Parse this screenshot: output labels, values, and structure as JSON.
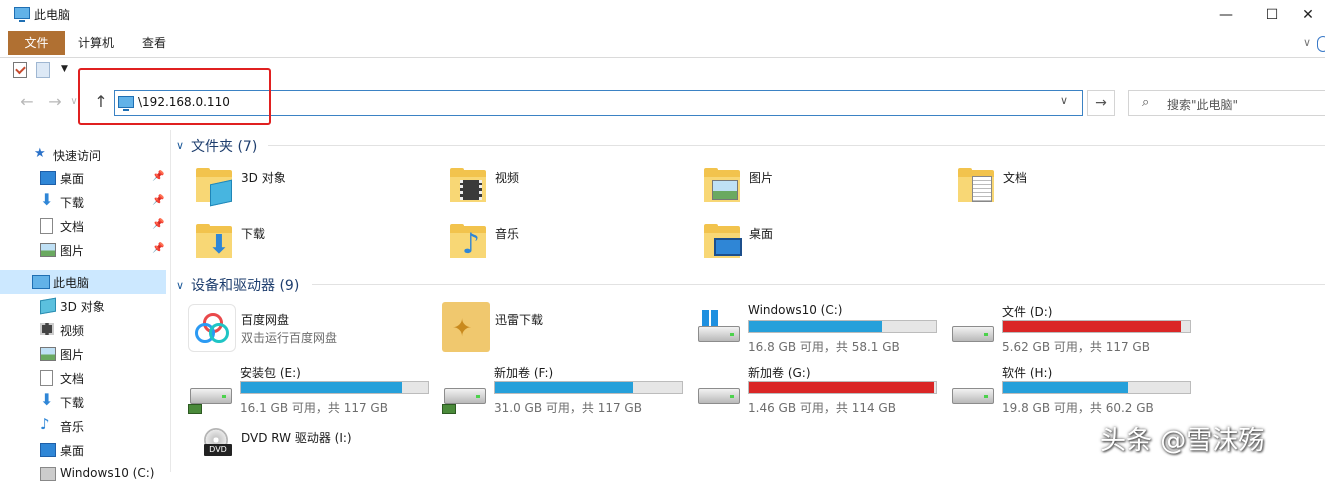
{
  "window": {
    "title": "此电脑",
    "minimize": "—",
    "maximize": "☐",
    "close": "✕"
  },
  "ribbon": {
    "tab_file": "文件",
    "tab_computer": "计算机",
    "tab_view": "查看",
    "collapse": "∨"
  },
  "qat": {
    "dropdown": "▼"
  },
  "nav": {
    "back": "←",
    "forward": "→",
    "recent": "∨",
    "up": "↑"
  },
  "address": {
    "value": "\\192.168.0.110",
    "dropdown": "∨",
    "go": "→"
  },
  "search": {
    "icon": "⌕",
    "placeholder": "搜索\"此电脑\""
  },
  "sidebar": {
    "quick_access": "快速访问",
    "items": [
      {
        "label": "桌面",
        "pinned": "📌",
        "icon": "desktop-icon"
      },
      {
        "label": "下载",
        "pinned": "📌",
        "icon": "download-icon"
      },
      {
        "label": "文档",
        "pinned": "📌",
        "icon": "documents-icon"
      },
      {
        "label": "图片",
        "pinned": "📌",
        "icon": "pictures-icon"
      }
    ],
    "this_pc": "此电脑",
    "pc_items": [
      {
        "label": "3D 对象",
        "icon": "3d-objects-icon"
      },
      {
        "label": "视频",
        "icon": "videos-icon"
      },
      {
        "label": "图片",
        "icon": "pictures-icon"
      },
      {
        "label": "文档",
        "icon": "documents-icon"
      },
      {
        "label": "下载",
        "icon": "download-icon"
      },
      {
        "label": "音乐",
        "icon": "music-icon"
      },
      {
        "label": "桌面",
        "icon": "desktop-icon"
      },
      {
        "label": "Windows10 (C:)",
        "icon": "drive-icon"
      }
    ]
  },
  "folders_section": {
    "chevron": "∨",
    "title": "文件夹 (7)"
  },
  "folders": [
    {
      "label": "3D 对象",
      "icon": "3d-objects-icon"
    },
    {
      "label": "视频",
      "icon": "videos-icon"
    },
    {
      "label": "图片",
      "icon": "pictures-icon"
    },
    {
      "label": "文档",
      "icon": "documents-icon"
    },
    {
      "label": "下载",
      "icon": "download-icon"
    },
    {
      "label": "音乐",
      "icon": "music-icon"
    },
    {
      "label": "桌面",
      "icon": "desktop-icon"
    }
  ],
  "drives_section": {
    "chevron": "∨",
    "title": "设备和驱动器 (9)"
  },
  "apps": [
    {
      "label": "百度网盘",
      "sub": "双击运行百度网盘",
      "icon": "baidu-netdisk-icon"
    },
    {
      "label": "迅雷下载",
      "icon": "xunlei-icon"
    }
  ],
  "drives": [
    {
      "name": "Windows10 (C:)",
      "free": "16.8 GB 可用，共 58.1 GB",
      "used_fraction": 0.71,
      "bar_color": "#26a0da",
      "icon": "windows-drive-icon"
    },
    {
      "name": "文件 (D:)",
      "free": "5.62 GB 可用，共 117 GB",
      "used_fraction": 0.95,
      "bar_color": "#da2626",
      "icon": "drive-icon"
    },
    {
      "name": "安装包 (E:)",
      "free": "16.1 GB 可用，共 117 GB",
      "used_fraction": 0.86,
      "bar_color": "#26a0da",
      "icon": "network-drive-icon"
    },
    {
      "name": "新加卷 (F:)",
      "free": "31.0 GB 可用，共 117 GB",
      "used_fraction": 0.74,
      "bar_color": "#26a0da",
      "icon": "network-drive-icon"
    },
    {
      "name": "新加卷 (G:)",
      "free": "1.46 GB 可用，共 114 GB",
      "used_fraction": 0.99,
      "bar_color": "#da2626",
      "icon": "drive-icon"
    },
    {
      "name": "软件 (H:)",
      "free": "19.8 GB 可用，共 60.2 GB",
      "used_fraction": 0.67,
      "bar_color": "#26a0da",
      "icon": "drive-icon"
    }
  ],
  "dvd": {
    "name": "DVD RW 驱动器 (I:)",
    "badge": "DVD",
    "icon": "dvd-drive-icon"
  },
  "watermark": "头条 @雪沫殇"
}
